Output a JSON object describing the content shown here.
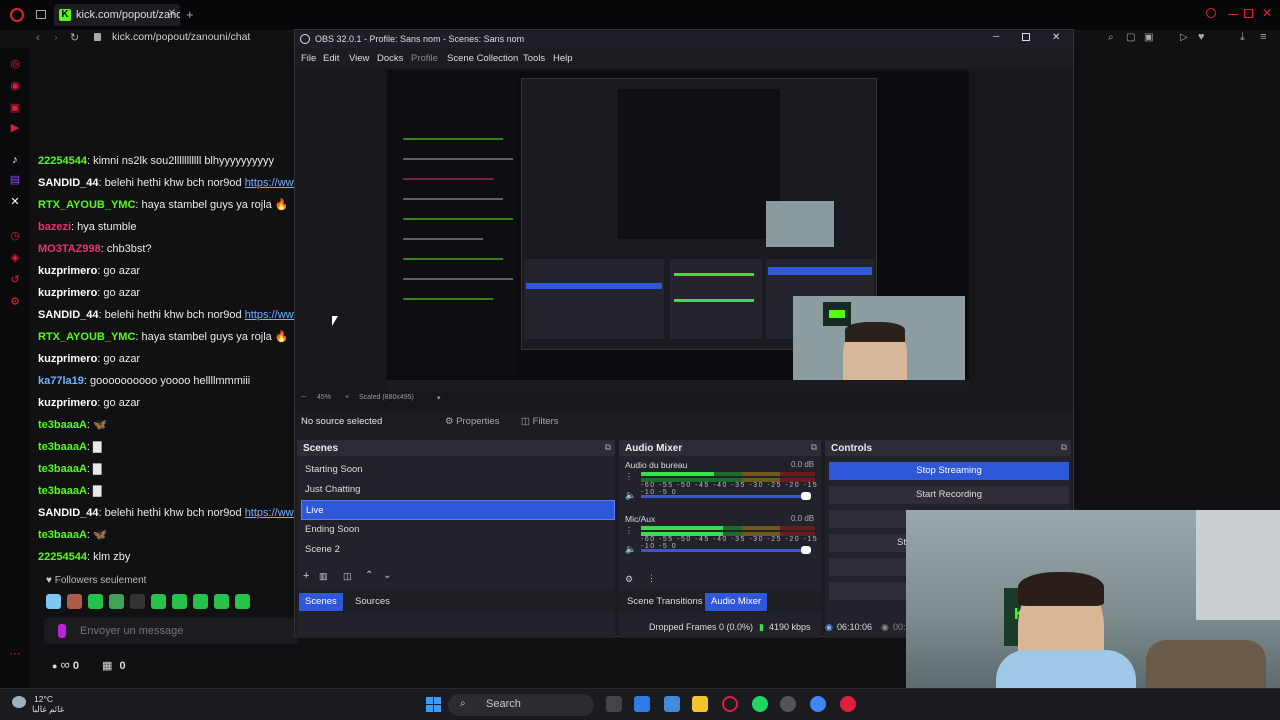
{
  "browser": {
    "tab_title": "kick.com/popout/zanouni",
    "url": "kick.com/popout/zanouni/chat"
  },
  "chat": {
    "messages": [
      {
        "user": "22254544",
        "color": "#53fc18",
        "text": ": kimni ns2lk sou2lllllllllll blhyyyyyyyyyy"
      },
      {
        "user": "SANDID_44",
        "color": "#ffffff",
        "text": ": belehi hethi khw bch nor9od ",
        "link": "https://www.i"
      },
      {
        "user": "RTX_AYOUB_YMC",
        "color": "#53fc18",
        "text": ": haya stambel guys ya rojla 🔥"
      },
      {
        "user": "bazezi",
        "color": "#e8336b",
        "text": ": hya stumble"
      },
      {
        "user": "MO3TAZ998",
        "color": "#e8336b",
        "text": ": chb3bst?"
      },
      {
        "user": "kuzprimero",
        "color": "#ffffff",
        "text": ": go azar"
      },
      {
        "user": "kuzprimero",
        "color": "#ffffff",
        "text": ": go azar"
      },
      {
        "user": "SANDID_44",
        "color": "#ffffff",
        "text": ": belehi hethi khw bch nor9od ",
        "link": "https://www.i"
      },
      {
        "user": "RTX_AYOUB_YMC",
        "color": "#53fc18",
        "text": ": haya stambel guys ya rojla 🔥"
      },
      {
        "user": "kuzprimero",
        "color": "#ffffff",
        "text": ": go azar"
      },
      {
        "user": "ka77la19",
        "color": "#6fb3ff",
        "text": ": goooooooooo yoooo hellllmmmiii"
      },
      {
        "user": "kuzprimero",
        "color": "#ffffff",
        "text": ": go azar"
      },
      {
        "user": "te3baaaA",
        "color": "#53fc18",
        "text": ": 🦋"
      },
      {
        "user": "te3baaaA",
        "color": "#53fc18",
        "text": ": ▇"
      },
      {
        "user": "te3baaaA",
        "color": "#53fc18",
        "text": ": ▇"
      },
      {
        "user": "te3baaaA",
        "color": "#53fc18",
        "text": ": ▇"
      },
      {
        "user": "SANDID_44",
        "color": "#ffffff",
        "text": ": belehi hethi khw bch nor9od ",
        "link": "https://www.i"
      },
      {
        "user": "te3baaaA",
        "color": "#53fc18",
        "text": ": 🦋"
      },
      {
        "user": "22254544",
        "color": "#53fc18",
        "text": ": klm zby"
      }
    ],
    "followers_only": "Followers seulement",
    "input_placeholder": "Envoyer un message",
    "footer_count_1": "0",
    "footer_count_2": "0"
  },
  "obs": {
    "title": "OBS 32.0.1 - Profile: Sans nom - Scenes: Sans nom",
    "menu": [
      "File",
      "Edit",
      "View",
      "Docks",
      "Profile",
      "Scene Collection",
      "Tools",
      "Help"
    ],
    "preview_zoom": "45%",
    "preview_scale": "Scaled (880x495)",
    "no_source": "No source selected",
    "properties": "Properties",
    "filters": "Filters",
    "scenes_title": "Scenes",
    "scenes": [
      "Starting Soon",
      "Just Chatting",
      "Live",
      "Ending Soon",
      "Scene 2"
    ],
    "active_scene": "Live",
    "scenes_tab": "Scenes",
    "sources_tab": "Sources",
    "mixer_title": "Audio Mixer",
    "channels": [
      {
        "name": "Audio du bureau",
        "db": "0.0 dB",
        "level": 0.42
      },
      {
        "name": "Mic/Aux",
        "db": "0.0 dB",
        "level": 0.47
      }
    ],
    "meter_scale": "-60 -55 -50 -45 -40 -35 -30 -25 -20 -15 -10 -5 0",
    "transitions_tab": "Scene Transitions",
    "mixer_tab": "Audio Mixer",
    "controls_title": "Controls",
    "stop_streaming": "Stop Streaming",
    "start_recording": "Start Recording",
    "studio_partial": "St",
    "dropped_frames": "Dropped Frames 0 (0.0%)",
    "bitrate": "4190 kbps",
    "live_time": "06:10:06",
    "rec_time": "00:"
  },
  "taskbar": {
    "temperature": "12°C",
    "weather_text": "غائم غالبا",
    "search": "Search"
  },
  "colors": {
    "accent_blue": "#2f58d8",
    "kick_green": "#53fc18",
    "opera_red": "#e0203a"
  }
}
